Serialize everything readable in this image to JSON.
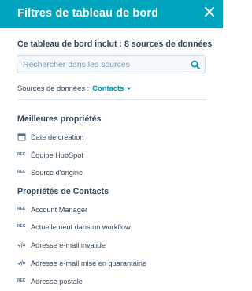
{
  "header": {
    "title": "Filtres de tableau de bord"
  },
  "intro": "Ce tableau de bord inclut : 8 sources de données",
  "search": {
    "placeholder": "Rechercher dans les sources"
  },
  "sources": {
    "label": "Sources de données :",
    "value": "Contacts"
  },
  "sections": [
    {
      "title": "Meilleures propriétés",
      "items": [
        {
          "icon": "calendar-icon",
          "label": "Date de création"
        },
        {
          "icon": "rec-icon",
          "label": "Équipe HubSpot"
        },
        {
          "icon": "rec-icon",
          "label": "Source d'origine"
        }
      ]
    },
    {
      "title": "Propriétés de Contacts",
      "items": [
        {
          "icon": "rec-icon",
          "label": "Account Manager"
        },
        {
          "icon": "rec-icon",
          "label": "Actuellement dans un workflow"
        },
        {
          "icon": "boolean-icon",
          "label": "Adresse e-mail invalide"
        },
        {
          "icon": "boolean-icon",
          "label": "Adresse e-mail mise en quarantaine"
        },
        {
          "icon": "rec-icon",
          "label": "Adresse postale"
        }
      ]
    }
  ],
  "colors": {
    "header_bg": "#00a4bd",
    "link": "#0091ae",
    "text": "#33475b"
  }
}
